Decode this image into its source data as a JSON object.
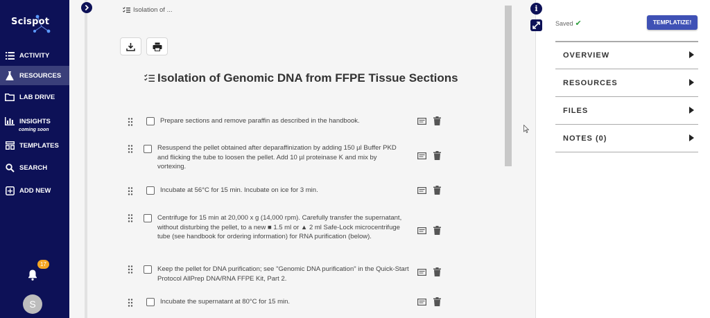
{
  "app": {
    "logo": "Scispot"
  },
  "sidebar": {
    "items": [
      {
        "label": "ACTIVITY",
        "icon": "activity-icon"
      },
      {
        "label": "RESOURCES",
        "icon": "flask-icon"
      },
      {
        "label": "LAB DRIVE",
        "icon": "folder-icon"
      },
      {
        "label": "INSIGHTS",
        "icon": "bar-chart-icon",
        "sub": "coming soon"
      },
      {
        "label": "TEMPLATES",
        "icon": "templates-icon"
      },
      {
        "label": "SEARCH",
        "icon": "search-icon"
      },
      {
        "label": "ADD NEW",
        "icon": "plus-box-icon"
      }
    ],
    "notification_count": "17",
    "avatar_initial": "S"
  },
  "main": {
    "breadcrumb": "Isolation of ...",
    "title": "Isolation of Genomic DNA from FFPE Tissue Sections",
    "steps": [
      {
        "text": "Prepare sections and remove paraffin as described in the handbook."
      },
      {
        "text": "Resuspend the pellet obtained after deparaffinization by adding 150 µl Buffer PKD and flicking the tube to loosen the pellet. Add 10 µl proteinase K and mix by vortexing."
      },
      {
        "text": "Incubate at 56°C for 15 min. Incubate on ice for 3 min."
      },
      {
        "text": "Centrifuge for 15 min at 20,000 x g (14,000 rpm). Carefully transfer the supernatant, without disturbing the pellet, to a new ■ 1.5 ml or ▲ 2 ml Safe-Lock microcentrifuge tube (see handbook for ordering information) for RNA purification (below)."
      },
      {
        "text": "Keep the pellet for DNA purification; see \"Genomic DNA purification\" in the Quick-Start Protocol AllPrep DNA/RNA FFPE Kit, Part 2."
      },
      {
        "text": "Incubate the supernatant at 80°C for 15 min."
      }
    ]
  },
  "right_panel": {
    "saved_label": "Saved",
    "templatize_label": "TEMPLATIZE!",
    "sections": [
      {
        "label": "OVERVIEW"
      },
      {
        "label": "RESOURCES"
      },
      {
        "label": "FILES"
      },
      {
        "label": "NOTES (0)"
      }
    ]
  },
  "colors": {
    "sidebar_bg": "#0d1157",
    "accent": "#3f51b5",
    "badge": "#f5a623"
  }
}
